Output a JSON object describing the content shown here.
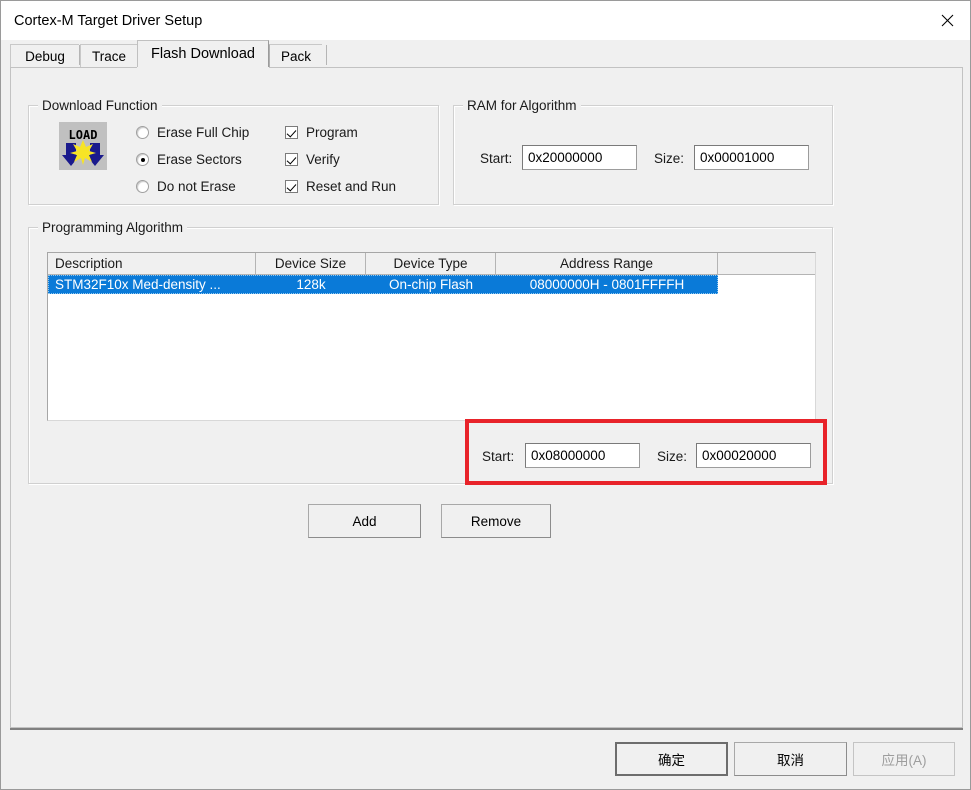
{
  "window": {
    "title": "Cortex-M Target Driver Setup",
    "close_icon": "close-icon"
  },
  "tabs": [
    {
      "label": "Debug",
      "active": false
    },
    {
      "label": "Trace",
      "active": false
    },
    {
      "label": "Flash Download",
      "active": true
    },
    {
      "label": "Pack",
      "active": false
    }
  ],
  "download_function": {
    "legend": "Download Function",
    "icon_text": "LOAD",
    "radios": [
      {
        "label": "Erase Full Chip",
        "checked": false
      },
      {
        "label": "Erase Sectors",
        "checked": true
      },
      {
        "label": "Do not Erase",
        "checked": false
      }
    ],
    "checkboxes": [
      {
        "label": "Program",
        "checked": true
      },
      {
        "label": "Verify",
        "checked": true
      },
      {
        "label": "Reset and Run",
        "checked": true
      }
    ]
  },
  "ram_for_algorithm": {
    "legend": "RAM for Algorithm",
    "start_label": "Start:",
    "start_value": "0x20000000",
    "size_label": "Size:",
    "size_value": "0x00001000"
  },
  "programming_algorithm": {
    "legend": "Programming Algorithm",
    "columns": [
      "Description",
      "Device Size",
      "Device Type",
      "Address Range",
      ""
    ],
    "rows": [
      {
        "description": "STM32F10x Med-density ...",
        "device_size": "128k",
        "device_type": "On-chip Flash",
        "address_range": "08000000H - 0801FFFFH",
        "selected": true
      }
    ],
    "start_label": "Start:",
    "start_value": "0x08000000",
    "size_label": "Size:",
    "size_value": "0x00020000",
    "highlight_color": "#e8232a",
    "selection_color": "#0a7ad8",
    "add_label": "Add",
    "remove_label": "Remove"
  },
  "footer": {
    "ok_label": "确定",
    "cancel_label": "取消",
    "apply_label": "应用(A)",
    "apply_disabled": true
  }
}
